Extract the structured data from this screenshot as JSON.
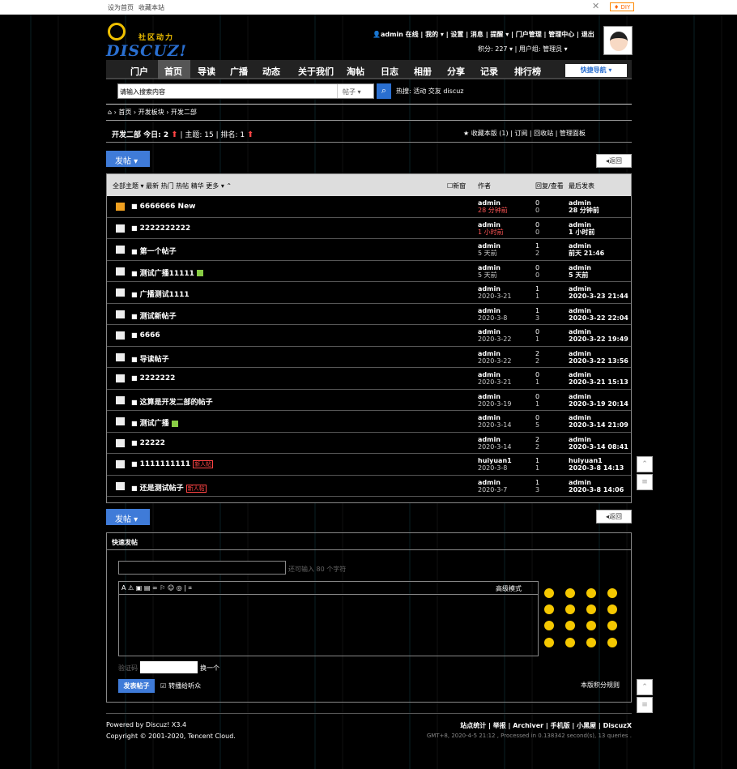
{
  "topbar": {
    "set_home": "设为首页",
    "bookmark": "收藏本站",
    "diy": "DIY"
  },
  "logo": {
    "text": "DISCUZ!",
    "tagline": "社区动力"
  },
  "user": {
    "line1": "admin 在线 | 我的 ▾ | 设置 | 消息 | 提醒 ▾ | 门户管理 | 管理中心 | 退出",
    "line2": "积分: 227 ▾  |  用户组: 管理员 ▾"
  },
  "nav": {
    "items": [
      "门户",
      "首页",
      "导读",
      "广播",
      "动态",
      "关于我们",
      "淘帖",
      "日志",
      "相册",
      "分享",
      "记录",
      "排行榜"
    ],
    "quick": "快捷导航 ▾"
  },
  "search": {
    "placeholder": "请输入搜索内容",
    "scope": "帖子 ▾",
    "hot": "热搜: 活动 交友 discuz"
  },
  "breadcrumb": "⌂ › 首页 › 开发板块 › 开发二部",
  "forum": {
    "info_left": "开发二部  今日: 2 ",
    "info_mid": " | 主题: 15 | 排名: 1 ",
    "info_right": "★ 收藏本版 (1)  |  订阅  |  回收站  |  管理面板"
  },
  "buttons": {
    "post": "发帖 ▾",
    "back": "◂返回",
    "submit": "发表帖子"
  },
  "list_header": {
    "filter": "全部主题 ▾  最新  热门  热帖  精华  更多 ▾  ⌃",
    "newwin": "☐新窗",
    "author": "作者",
    "replies": "回复/查看",
    "last": "最后发表"
  },
  "threads": [
    {
      "title": "6666666 New",
      "author": "admin",
      "date": "28 分钟前",
      "date_red": true,
      "r": "0",
      "v": "0",
      "lu": "admin",
      "lt": "28 分钟前",
      "icon": "y"
    },
    {
      "title": "2222222222",
      "author": "admin",
      "date": "1 小时前",
      "date_red": true,
      "r": "0",
      "v": "0",
      "lu": "admin",
      "lt": "1 小时前",
      "icon": "w"
    },
    {
      "title": "第一个帖子",
      "author": "admin",
      "date": "5 天前",
      "r": "1",
      "v": "2",
      "lu": "admin",
      "lt": "前天 21:46",
      "icon": "w"
    },
    {
      "title": "测试广播11111",
      "author": "admin",
      "date": "5 天前",
      "r": "0",
      "v": "0",
      "lu": "admin",
      "lt": "5 天前",
      "icon": "w",
      "att": true
    },
    {
      "title": "广播测试1111",
      "author": "admin",
      "date": "2020-3-21",
      "r": "1",
      "v": "1",
      "lu": "admin",
      "lt": "2020-3-23 21:44",
      "icon": "w"
    },
    {
      "title": "测试新帖子",
      "author": "admin",
      "date": "2020-3-8",
      "r": "1",
      "v": "3",
      "lu": "admin",
      "lt": "2020-3-22 22:04",
      "icon": "w"
    },
    {
      "title": "6666",
      "author": "admin",
      "date": "2020-3-22",
      "r": "0",
      "v": "1",
      "lu": "admin",
      "lt": "2020-3-22 19:49",
      "icon": "w"
    },
    {
      "title": "导读帖子",
      "author": "admin",
      "date": "2020-3-22",
      "r": "2",
      "v": "2",
      "lu": "admin",
      "lt": "2020-3-22 13:56",
      "icon": "w"
    },
    {
      "title": "2222222",
      "author": "admin",
      "date": "2020-3-21",
      "r": "0",
      "v": "1",
      "lu": "admin",
      "lt": "2020-3-21 15:13",
      "icon": "w"
    },
    {
      "title": "这算是开发二部的帖子",
      "author": "admin",
      "date": "2020-3-19",
      "r": "0",
      "v": "1",
      "lu": "admin",
      "lt": "2020-3-19 20:14",
      "icon": "w"
    },
    {
      "title": "测试广播",
      "author": "admin",
      "date": "2020-3-14",
      "r": "0",
      "v": "5",
      "lu": "admin",
      "lt": "2020-3-14 21:09",
      "icon": "w",
      "att": true
    },
    {
      "title": "22222",
      "author": "admin",
      "date": "2020-3-14",
      "r": "2",
      "v": "2",
      "lu": "admin",
      "lt": "2020-3-14 08:41",
      "icon": "w"
    },
    {
      "title": "1111111111",
      "author": "huiyuan1",
      "date": "2020-3-8",
      "r": "1",
      "v": "1",
      "lu": "huiyuan1",
      "lt": "2020-3-8 14:13",
      "icon": "p",
      "tag": "新人帖"
    },
    {
      "title": "还是测试帖子",
      "author": "admin",
      "date": "2020-3-7",
      "r": "1",
      "v": "3",
      "lu": "admin",
      "lt": "2020-3-8 14:06",
      "icon": "w",
      "tag": "新人帖"
    }
  ],
  "quickpost": {
    "title": "快速发帖",
    "hint": "还可输入 80 个字符",
    "toolbar": "A  ⚠  ▣  ▤  ∞  ⚐  ☺  ◎  |  ⌗",
    "advanced": "高级模式",
    "captcha_label": "验证码",
    "captcha_change": "换一个",
    "rebroadcast": "转播给听众",
    "rules": "本版积分规则"
  },
  "footer": {
    "powered": "Powered by Discuz! X3.4",
    "copyright": "Copyright © 2001-2020, Tencent Cloud.",
    "links": "站点统计 | 举报 | Archiver | 手机版 | 小黑屋 | DiscuzX",
    "gmt": "GMT+8, 2020-4-5 21:12 , Processed in 0.138342 second(s), 13 queries ."
  },
  "side": {
    "top": "⌃",
    "list": "≡"
  }
}
